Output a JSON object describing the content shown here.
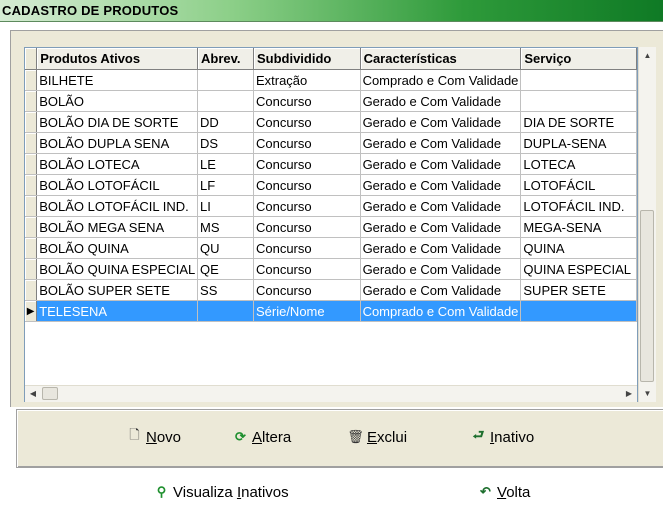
{
  "window": {
    "title": "CADASTRO DE PRODUTOS"
  },
  "grid": {
    "columns": [
      "Produtos Ativos",
      "Abrev.",
      "Subdividido",
      "Características",
      "Serviço"
    ],
    "rows": [
      [
        "BILHETE",
        "",
        "Extração",
        "Comprado e Com Validade",
        ""
      ],
      [
        "BOLÃO",
        "",
        "Concurso",
        "Gerado e Com Validade",
        ""
      ],
      [
        "BOLÃO DIA DE SORTE",
        "DD",
        "Concurso",
        "Gerado e Com Validade",
        "DIA DE SORTE"
      ],
      [
        "BOLÃO DUPLA SENA",
        "DS",
        "Concurso",
        "Gerado e Com Validade",
        "DUPLA-SENA"
      ],
      [
        "BOLÃO LOTECA",
        "LE",
        "Concurso",
        "Gerado e Com Validade",
        "LOTECA"
      ],
      [
        "BOLÃO LOTOFÁCIL",
        "LF",
        "Concurso",
        "Gerado e Com Validade",
        "LOTOFÁCIL"
      ],
      [
        "BOLÃO LOTOFÁCIL IND.",
        "LI",
        "Concurso",
        "Gerado e Com Validade",
        "LOTOFÁCIL IND."
      ],
      [
        "BOLÃO MEGA SENA",
        "MS",
        "Concurso",
        "Gerado e Com Validade",
        "MEGA-SENA"
      ],
      [
        "BOLÃO QUINA",
        "QU",
        "Concurso",
        "Gerado e Com Validade",
        "QUINA"
      ],
      [
        "BOLÃO QUINA ESPECIAL",
        "QE",
        "Concurso",
        "Gerado e Com Validade",
        "QUINA ESPECIAL"
      ],
      [
        "BOLÃO SUPER SETE",
        "SS",
        "Concurso",
        "Gerado e Com Validade",
        "SUPER SETE"
      ],
      [
        "TELESENA",
        "",
        "Série/Nome",
        "Comprado e Com Validade",
        ""
      ]
    ],
    "selected_row_index": 11,
    "selected_indicator": "▶"
  },
  "scrollbars": {
    "up": "▲",
    "down": "▼",
    "left": "◀",
    "right": "▶"
  },
  "actions": {
    "novo": {
      "label": "Novo",
      "accel": "N",
      "rest": "ovo",
      "icon": "new-document-icon",
      "glyph": "🗋"
    },
    "altera": {
      "label": "Altera",
      "accel": "A",
      "rest": "ltera",
      "icon": "refresh-edit-icon",
      "glyph": "⟳"
    },
    "exclui": {
      "label": "Exclui",
      "accel": "E",
      "rest": "xclui",
      "icon": "trash-icon",
      "glyph": "🗑"
    },
    "inativo": {
      "label": "Inativo",
      "accel": "I",
      "rest": "nativo",
      "icon": "deactivate-arrow-icon",
      "glyph": "⮐"
    }
  },
  "footer": {
    "visualiza": {
      "label": "Visualiza Inativos",
      "pre": "Visualiza ",
      "accel": "I",
      "rest": "nativos",
      "icon": "magnifier-icon",
      "glyph": "⚲"
    },
    "volta": {
      "label": "Volta",
      "accel": "V",
      "rest": "olta",
      "icon": "back-arrow-icon",
      "glyph": "↶"
    }
  },
  "colors": {
    "selection": "#3399ff",
    "panel": "#ece9d8",
    "title_gradient_end": "#0f7a25"
  }
}
